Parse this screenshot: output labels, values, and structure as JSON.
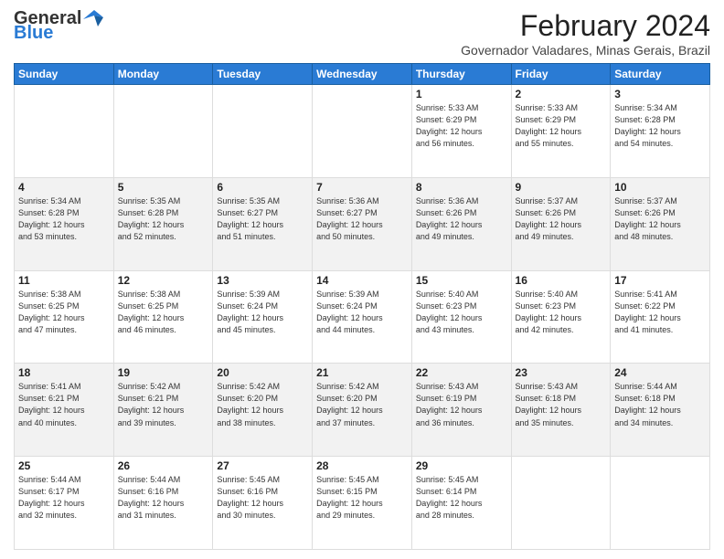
{
  "header": {
    "logo_general": "General",
    "logo_blue": "Blue",
    "month": "February 2024",
    "location": "Governador Valadares, Minas Gerais, Brazil"
  },
  "days_of_week": [
    "Sunday",
    "Monday",
    "Tuesday",
    "Wednesday",
    "Thursday",
    "Friday",
    "Saturday"
  ],
  "weeks": [
    [
      {
        "day": "",
        "info": ""
      },
      {
        "day": "",
        "info": ""
      },
      {
        "day": "",
        "info": ""
      },
      {
        "day": "",
        "info": ""
      },
      {
        "day": "1",
        "info": "Sunrise: 5:33 AM\nSunset: 6:29 PM\nDaylight: 12 hours\nand 56 minutes."
      },
      {
        "day": "2",
        "info": "Sunrise: 5:33 AM\nSunset: 6:29 PM\nDaylight: 12 hours\nand 55 minutes."
      },
      {
        "day": "3",
        "info": "Sunrise: 5:34 AM\nSunset: 6:28 PM\nDaylight: 12 hours\nand 54 minutes."
      }
    ],
    [
      {
        "day": "4",
        "info": "Sunrise: 5:34 AM\nSunset: 6:28 PM\nDaylight: 12 hours\nand 53 minutes."
      },
      {
        "day": "5",
        "info": "Sunrise: 5:35 AM\nSunset: 6:28 PM\nDaylight: 12 hours\nand 52 minutes."
      },
      {
        "day": "6",
        "info": "Sunrise: 5:35 AM\nSunset: 6:27 PM\nDaylight: 12 hours\nand 51 minutes."
      },
      {
        "day": "7",
        "info": "Sunrise: 5:36 AM\nSunset: 6:27 PM\nDaylight: 12 hours\nand 50 minutes."
      },
      {
        "day": "8",
        "info": "Sunrise: 5:36 AM\nSunset: 6:26 PM\nDaylight: 12 hours\nand 49 minutes."
      },
      {
        "day": "9",
        "info": "Sunrise: 5:37 AM\nSunset: 6:26 PM\nDaylight: 12 hours\nand 49 minutes."
      },
      {
        "day": "10",
        "info": "Sunrise: 5:37 AM\nSunset: 6:26 PM\nDaylight: 12 hours\nand 48 minutes."
      }
    ],
    [
      {
        "day": "11",
        "info": "Sunrise: 5:38 AM\nSunset: 6:25 PM\nDaylight: 12 hours\nand 47 minutes."
      },
      {
        "day": "12",
        "info": "Sunrise: 5:38 AM\nSunset: 6:25 PM\nDaylight: 12 hours\nand 46 minutes."
      },
      {
        "day": "13",
        "info": "Sunrise: 5:39 AM\nSunset: 6:24 PM\nDaylight: 12 hours\nand 45 minutes."
      },
      {
        "day": "14",
        "info": "Sunrise: 5:39 AM\nSunset: 6:24 PM\nDaylight: 12 hours\nand 44 minutes."
      },
      {
        "day": "15",
        "info": "Sunrise: 5:40 AM\nSunset: 6:23 PM\nDaylight: 12 hours\nand 43 minutes."
      },
      {
        "day": "16",
        "info": "Sunrise: 5:40 AM\nSunset: 6:23 PM\nDaylight: 12 hours\nand 42 minutes."
      },
      {
        "day": "17",
        "info": "Sunrise: 5:41 AM\nSunset: 6:22 PM\nDaylight: 12 hours\nand 41 minutes."
      }
    ],
    [
      {
        "day": "18",
        "info": "Sunrise: 5:41 AM\nSunset: 6:21 PM\nDaylight: 12 hours\nand 40 minutes."
      },
      {
        "day": "19",
        "info": "Sunrise: 5:42 AM\nSunset: 6:21 PM\nDaylight: 12 hours\nand 39 minutes."
      },
      {
        "day": "20",
        "info": "Sunrise: 5:42 AM\nSunset: 6:20 PM\nDaylight: 12 hours\nand 38 minutes."
      },
      {
        "day": "21",
        "info": "Sunrise: 5:42 AM\nSunset: 6:20 PM\nDaylight: 12 hours\nand 37 minutes."
      },
      {
        "day": "22",
        "info": "Sunrise: 5:43 AM\nSunset: 6:19 PM\nDaylight: 12 hours\nand 36 minutes."
      },
      {
        "day": "23",
        "info": "Sunrise: 5:43 AM\nSunset: 6:18 PM\nDaylight: 12 hours\nand 35 minutes."
      },
      {
        "day": "24",
        "info": "Sunrise: 5:44 AM\nSunset: 6:18 PM\nDaylight: 12 hours\nand 34 minutes."
      }
    ],
    [
      {
        "day": "25",
        "info": "Sunrise: 5:44 AM\nSunset: 6:17 PM\nDaylight: 12 hours\nand 32 minutes."
      },
      {
        "day": "26",
        "info": "Sunrise: 5:44 AM\nSunset: 6:16 PM\nDaylight: 12 hours\nand 31 minutes."
      },
      {
        "day": "27",
        "info": "Sunrise: 5:45 AM\nSunset: 6:16 PM\nDaylight: 12 hours\nand 30 minutes."
      },
      {
        "day": "28",
        "info": "Sunrise: 5:45 AM\nSunset: 6:15 PM\nDaylight: 12 hours\nand 29 minutes."
      },
      {
        "day": "29",
        "info": "Sunrise: 5:45 AM\nSunset: 6:14 PM\nDaylight: 12 hours\nand 28 minutes."
      },
      {
        "day": "",
        "info": ""
      },
      {
        "day": "",
        "info": ""
      }
    ]
  ],
  "row_shading": [
    false,
    true,
    false,
    true,
    false
  ]
}
